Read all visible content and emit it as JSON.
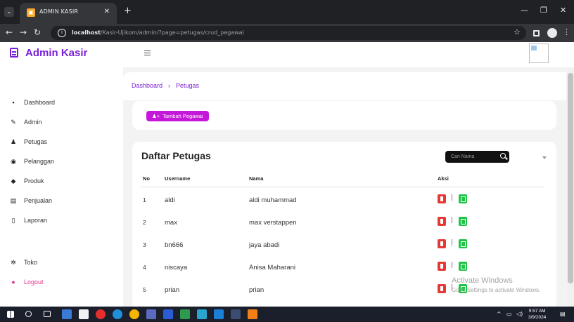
{
  "browser": {
    "tab_title": "ADMIN KASIR",
    "url_host": "localhost",
    "url_path": "/Kasir-Ujikom/admin/?page=petugas/crud_pegawai"
  },
  "sidebar": {
    "brand": "Admin Kasir",
    "items": [
      {
        "label": "Dashboard",
        "icon": "dashboard-icon"
      },
      {
        "label": "Admin",
        "icon": "wrench-icon"
      },
      {
        "label": "Petugas",
        "icon": "users-icon"
      },
      {
        "label": "Pelanggan",
        "icon": "circle-user-icon"
      },
      {
        "label": "Produk",
        "icon": "box-icon"
      },
      {
        "label": "Penjualan",
        "icon": "receipt-icon"
      },
      {
        "label": "Laporan",
        "icon": "document-icon"
      },
      {
        "label": "Toko",
        "icon": "gear-icon"
      },
      {
        "label": "Logout",
        "icon": "logout-icon"
      }
    ]
  },
  "breadcrumb": {
    "root": "Dashboard",
    "current": "Petugas"
  },
  "actions": {
    "add_label": "Tambah Pegawai"
  },
  "table": {
    "title": "Daftar Petugas",
    "search_placeholder": "Cari Nama",
    "columns": [
      "No",
      "Username",
      "Nama",
      "Aksi"
    ],
    "action_separator": "|",
    "rows": [
      {
        "no": "1",
        "username": "aldi",
        "nama": "aldi muhammad"
      },
      {
        "no": "2",
        "username": "max",
        "nama": "max verstappen"
      },
      {
        "no": "3",
        "username": "bn666",
        "nama": "jaya abadi"
      },
      {
        "no": "4",
        "username": "niscaya",
        "nama": "Anisa Maharani"
      },
      {
        "no": "5",
        "username": "prian",
        "nama": "prian"
      }
    ]
  },
  "watermark": {
    "line1": "Activate Windows",
    "line2": "Go to Settings to activate Windows."
  },
  "taskbar": {
    "time": "9:57 AM",
    "date": "3/9/2024"
  },
  "colors": {
    "brand": "#7a1fd6",
    "add_button": "#c417d9",
    "delete": "#e53935",
    "edit": "#1fc447",
    "logout": "#e0348a"
  }
}
